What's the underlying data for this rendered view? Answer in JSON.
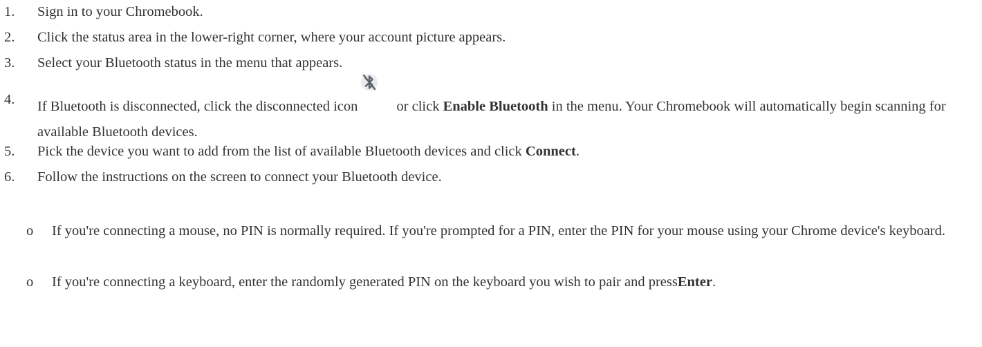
{
  "steps": [
    {
      "num": "1.",
      "text": "Sign in to your Chromebook."
    },
    {
      "num": "2.",
      "text": "Click the status area in the lower-right corner, where your account picture appears."
    },
    {
      "num": "3.",
      "text": "Select your Bluetooth status in the menu that appears."
    },
    {
      "num": "4.",
      "text_a": "If Bluetooth is disconnected, click the disconnected icon",
      "text_b": "or click",
      "bold_a": "Enable Bluetooth",
      "text_c": "in the menu. Your Chromebook will automatically begin scanning for available Bluetooth devices."
    },
    {
      "num": "5.",
      "text_a": "Pick the device you want to add from the list of available Bluetooth devices and click",
      "bold_a": "Connect",
      "text_b": "."
    },
    {
      "num": "6.",
      "text": "Follow the instructions on the screen to connect your Bluetooth device."
    }
  ],
  "substeps": [
    {
      "bullet": "o",
      "text": "If you're connecting a mouse, no PIN is normally required. If you're prompted for a PIN, enter the PIN for your mouse using your Chrome device's keyboard."
    },
    {
      "bullet": "o",
      "text_a": "If you're connecting a keyboard, enter the randomly generated PIN on the keyboard you wish to pair and press",
      "bold_a": "Enter",
      "text_b": "."
    }
  ],
  "icons": {
    "bluetooth_disabled": "bluetooth-disabled-icon"
  },
  "colors": {
    "text": "#333333",
    "icon": "#5f6368"
  }
}
